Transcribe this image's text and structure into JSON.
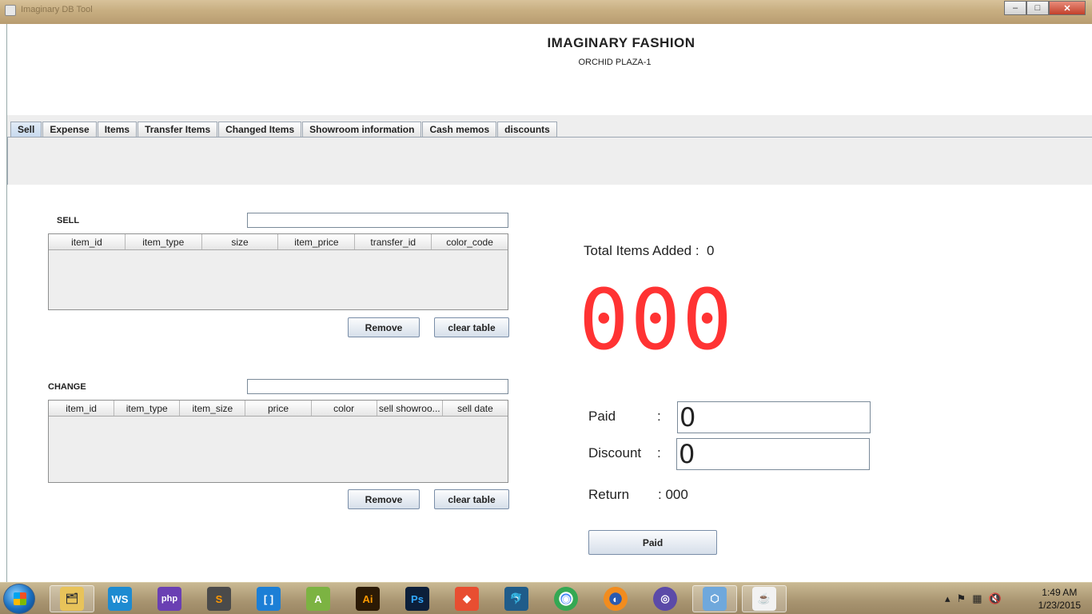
{
  "window": {
    "title": "Imaginary DB Tool",
    "controls": {
      "minimize": "–",
      "maximize": "□",
      "close": "✕"
    }
  },
  "header": {
    "title": "IMAGINARY FASHION",
    "subtitle": "ORCHID PLAZA-1"
  },
  "tabs": [
    {
      "label": "Sell",
      "active": true
    },
    {
      "label": "Expense"
    },
    {
      "label": "Items"
    },
    {
      "label": "Transfer Items"
    },
    {
      "label": "Changed Items"
    },
    {
      "label": "Showroom information"
    },
    {
      "label": "Cash memos"
    },
    {
      "label": "discounts"
    }
  ],
  "sell": {
    "label": "SELL",
    "input_value": "",
    "columns": [
      "item_id",
      "item_type",
      "size",
      "item_price",
      "transfer_id",
      "color_code"
    ],
    "remove_label": "Remove",
    "clear_label": "clear table"
  },
  "change": {
    "label": "CHANGE",
    "input_value": "",
    "columns": [
      "item_id",
      "item_type",
      "item_size",
      "price",
      "color",
      "sell showroo...",
      "sell date"
    ],
    "remove_label": "Remove",
    "clear_label": "clear table"
  },
  "summary": {
    "total_label": "Total Items Added :",
    "total_value": "0",
    "amount_display": "000",
    "paid_label": "Paid",
    "paid_colon": ":",
    "paid_value": "0",
    "discount_label": "Discount",
    "discount_colon": ":",
    "discount_value": "0",
    "return_label": "Return",
    "return_value": ": 000",
    "paid_button": "Paid"
  },
  "taskbar": {
    "apps": [
      {
        "name": "file-explorer-icon",
        "glyph": "🗂"
      },
      {
        "name": "webstorm-icon",
        "glyph": "WS"
      },
      {
        "name": "phpstorm-icon",
        "glyph": "php"
      },
      {
        "name": "sublime-text-icon",
        "glyph": "S"
      },
      {
        "name": "brackets-icon",
        "glyph": "[ ]"
      },
      {
        "name": "android-studio-icon",
        "glyph": "A"
      },
      {
        "name": "illustrator-icon",
        "glyph": "Ai"
      },
      {
        "name": "photoshop-icon",
        "glyph": "Ps"
      },
      {
        "name": "git-icon",
        "glyph": "◆"
      },
      {
        "name": "mysql-workbench-icon",
        "glyph": "🐬"
      },
      {
        "name": "chrome-icon",
        "glyph": "◉"
      },
      {
        "name": "firefox-icon",
        "glyph": "◐"
      },
      {
        "name": "vpn-client-icon",
        "glyph": "◎"
      },
      {
        "name": "virtualbox-icon",
        "glyph": "⬡"
      },
      {
        "name": "java-app-icon",
        "glyph": "☕"
      }
    ],
    "clock_time": "1:49 AM",
    "clock_date": "1/23/2015"
  },
  "colors": {
    "amount_red": "#ff3333",
    "tab_active": "#c8d9ee"
  }
}
